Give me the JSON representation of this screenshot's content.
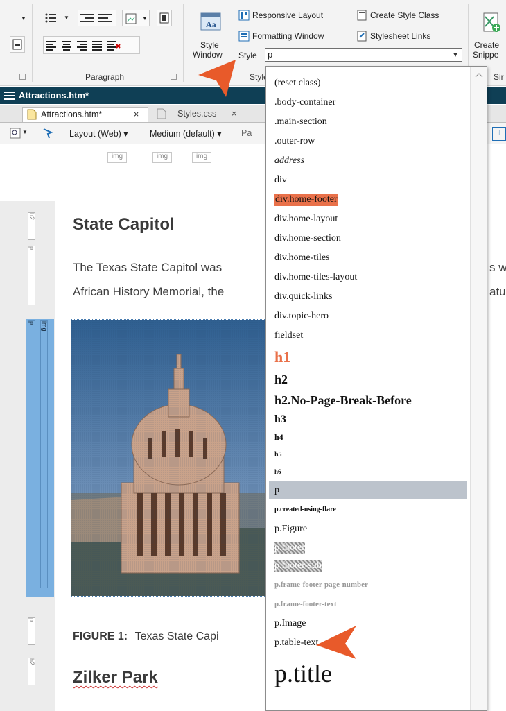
{
  "ribbon": {
    "paragraph_group_label": "Paragraph",
    "style_window_label_1": "Style",
    "style_window_label_2": "Window",
    "responsive_layout": "Responsive Layout",
    "formatting_window": "Formatting Window",
    "create_style_class": "Create Style Class",
    "stylesheet_links": "Stylesheet Links",
    "style_label": "Style",
    "style_value": "p",
    "style_group_label": "Style",
    "create_snippet_1": "Create",
    "create_snippet_2": "Snippe",
    "sin_label": "Sir"
  },
  "document": {
    "window_title": "Attractions.htm*",
    "tabs": [
      {
        "label": "Attractions.htm*",
        "close": "×",
        "active": true
      },
      {
        "label": "Styles.css",
        "close": "×",
        "active": false
      }
    ],
    "toolbar": {
      "layout": "Layout (Web)",
      "medium": "Medium (default)",
      "page_partial": "Pa"
    },
    "img_tags": [
      "img",
      "img",
      "img"
    ],
    "heading_1": "State Capitol",
    "para_line_1": "The Texas State Capitol was",
    "para_line_1_right": "s wi",
    "para_line_2": "African History Memorial, the",
    "para_line_2_right": "atu",
    "figure_prefix": "FIGURE 1:",
    "figure_caption": "Texas State Capi",
    "heading_2": "Zilker Park",
    "gutter_marks": [
      "h2",
      "p",
      "p",
      "img",
      "p",
      "h2"
    ]
  },
  "dropdown": {
    "options": [
      {
        "label": "(reset class)",
        "style": "plain"
      },
      {
        "label": ".body-container",
        "style": "plain"
      },
      {
        "label": ".main-section",
        "style": "plain"
      },
      {
        "label": ".outer-row",
        "style": "plain"
      },
      {
        "label": "address",
        "style": "italic"
      },
      {
        "label": "div",
        "style": "plain"
      },
      {
        "label": "div.home-footer",
        "style": "highlight"
      },
      {
        "label": "div.home-layout",
        "style": "plain"
      },
      {
        "label": "div.home-section",
        "style": "plain"
      },
      {
        "label": "div.home-tiles",
        "style": "plain"
      },
      {
        "label": "div.home-tiles-layout",
        "style": "plain"
      },
      {
        "label": "div.quick-links",
        "style": "plain"
      },
      {
        "label": "div.topic-hero",
        "style": "plain"
      },
      {
        "label": "fieldset",
        "style": "plain"
      },
      {
        "label": "h1",
        "style": "h1"
      },
      {
        "label": "h2",
        "style": "h2"
      },
      {
        "label": "h2.No-Page-Break-Before",
        "style": "h2"
      },
      {
        "label": "h3",
        "style": "h3"
      },
      {
        "label": "h4",
        "style": "h4"
      },
      {
        "label": "h5",
        "style": "h5"
      },
      {
        "label": "h6",
        "style": "h6"
      },
      {
        "label": "p",
        "style": "selected"
      },
      {
        "label": "p.created-using-flare",
        "style": "small-bold"
      },
      {
        "label": "p.Figure",
        "style": "plain"
      },
      {
        "label": "p.footer",
        "style": "hatched"
      },
      {
        "label": "p.footer-sub",
        "style": "hatched"
      },
      {
        "label": "p.frame-footer-page-number",
        "style": "grey"
      },
      {
        "label": "p.frame-footer-text",
        "style": "grey"
      },
      {
        "label": "p.Image",
        "style": "plain"
      },
      {
        "label": "p.table-text",
        "style": "plain"
      },
      {
        "label": "p.title",
        "style": "title"
      }
    ]
  },
  "colors": {
    "accent_orange": "#e9714a",
    "titlebar": "#0f3f55",
    "selected_row": "#bcc3cc"
  }
}
